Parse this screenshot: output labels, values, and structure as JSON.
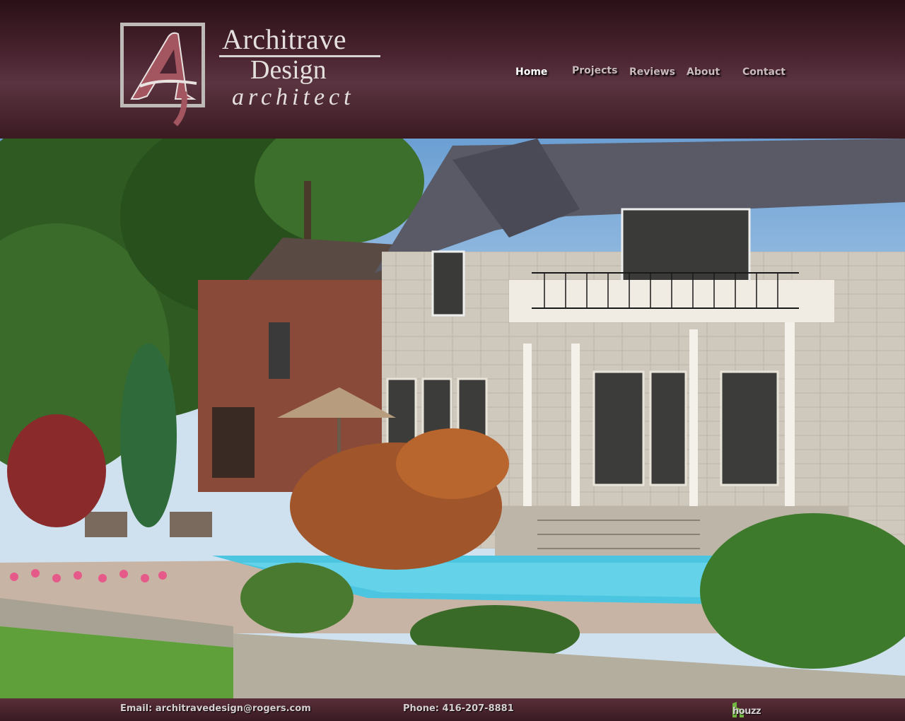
{
  "brand": {
    "monogram": "A",
    "name_line1": "Architrave",
    "name_line2": "Design",
    "tagline": "architect",
    "colors": {
      "header": "#4a2430",
      "logo_accent": "#a35560",
      "logo_gray": "#bdbab8"
    }
  },
  "nav": {
    "items": [
      {
        "label": "Home",
        "active": true
      },
      {
        "label": "Projects",
        "active": false
      },
      {
        "label": "Reviews",
        "active": false
      },
      {
        "label": "About",
        "active": false
      },
      {
        "label": "Contact",
        "active": false
      }
    ]
  },
  "hero": {
    "image": "photo of a stone house with pool and garden"
  },
  "footer": {
    "email": "Email: architravedesign@rogers.com",
    "phone": "Phone: 416-207-8881",
    "houzz_label": "houzz",
    "houzz_icon": "houzz-logo-icon"
  }
}
